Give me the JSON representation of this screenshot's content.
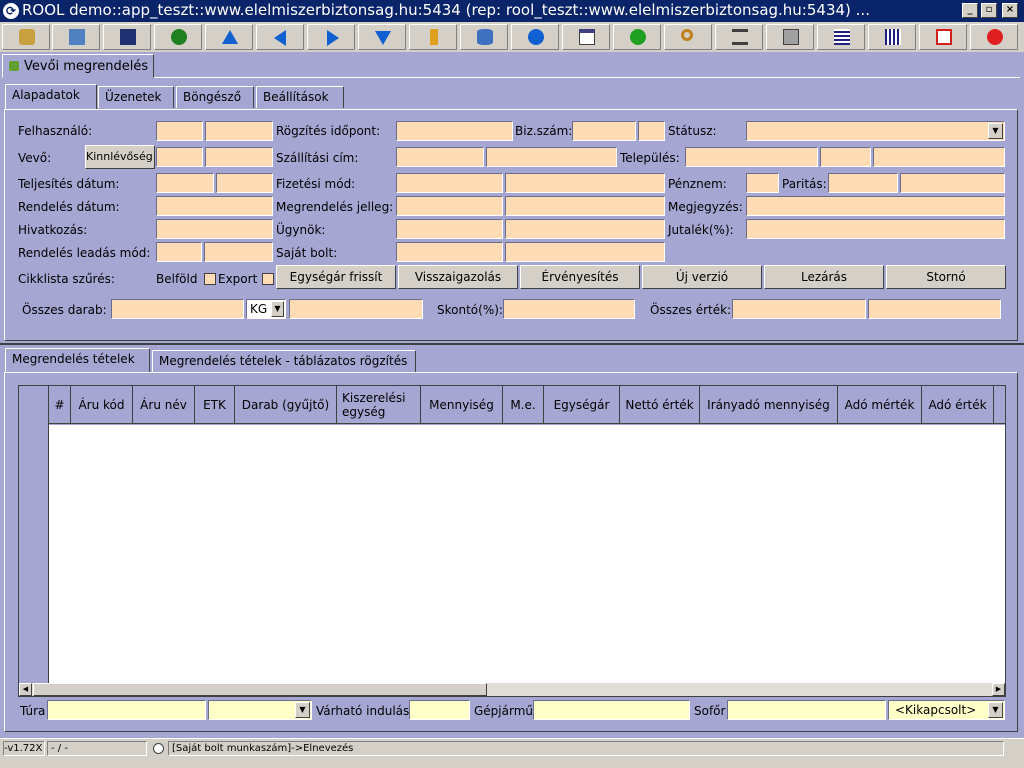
{
  "window": {
    "title": "ROOL demo::app_teszt::www.elelmiszerbiztonsag.hu:5434 (rep: rool_teszt::www.elelmiszerbiztonsag.hu:5434) ...",
    "app_icon": "refresh-circle-icon",
    "min": "_",
    "max": "▫",
    "close": "×"
  },
  "toolbar": {
    "icons": [
      "tools-icon",
      "open-folder-icon",
      "save-icon",
      "undo-arrow-icon",
      "first-record-icon",
      "prev-arrow-icon",
      "next-arrow-icon",
      "last-record-icon",
      "edit-pencil-icon",
      "database-icon",
      "info-icon",
      "window-icon",
      "refresh-icon",
      "search-magnifier-icon",
      "filter-icon",
      "print-icon",
      "grid-export-icon",
      "grid-icon",
      "fit-window-icon",
      "exit-icon"
    ]
  },
  "doc_tab": {
    "label": "Vevői megrendelés",
    "icon": "order-icon"
  },
  "top_tabs": [
    "Alapadatok",
    "Üzenetek",
    "Böngésző",
    "Beállítások"
  ],
  "form": {
    "felhasznalo": "Felhasználó:",
    "rogzites_idopont": "Rögzítés időpont:",
    "biz_szam": "Biz.szám:",
    "statusz": "Státusz:",
    "vevo": "Vevő:",
    "kinnlevoseg_button": "Kinnlévőség",
    "szallitasi_cim": "Szállítási cím:",
    "telepules": "Település:",
    "teljesites_datum": "Teljesítés dátum:",
    "fizetesi_mod": "Fizetési mód:",
    "penznem": "Pénznem:",
    "paritas": "Paritás:",
    "rendeles_datum": "Rendelés dátum:",
    "megrendeles_jelleg": "Megrendelés jelleg:",
    "megjegyzes": "Megjegyzés:",
    "hivatkozas": "Hivatkozás:",
    "ugynok": "Ügynök:",
    "jutalek": "Jutalék(%):",
    "rendeles_leadas_mod": "Rendelés leadás mód:",
    "sajat_bolt": "Saját bolt:",
    "cikklista_szures": "Cikklista szűrés:",
    "belfold": "Belföld",
    "export": "Export",
    "osszes_darab": "Összes darab:",
    "unit_value": "KG",
    "skonto": "Skontó(%):",
    "osszes_ertek": "Összes érték:"
  },
  "action_buttons": [
    "Egységár frissít",
    "Visszaigazolás",
    "Érvényesítés",
    "Új verzió",
    "Lezárás",
    "Stornó"
  ],
  "bottom_tabs": [
    "Megrendelés tételek",
    "Megrendelés tételek - táblázatos rögzítés"
  ],
  "table": {
    "columns": [
      "#",
      "Áru kód",
      "Áru név",
      "ETK",
      "Darab (gyűjtő)",
      "Kiszerelési egység",
      "Mennyiség",
      "M.e.",
      "Egységár",
      "Nettó érték",
      "Irányadó mennyiség",
      "Adó mérték",
      "Adó érték"
    ]
  },
  "footer": {
    "tura": "Túra",
    "varhato_indulas": "Várható indulás",
    "gepjarmu": "Gépjármű",
    "sofor": "Sofőr",
    "kikapcsolt": "<Kikapcsolt>"
  },
  "status": {
    "version": "-v1.72X",
    "separator": "- / -",
    "message": "[Saját bolt munkaszám]->Elnevezés"
  },
  "colors": {
    "background": "#a6a6d3",
    "field": "#ffdcb4",
    "field_yellow": "#ffffc8",
    "titlebar": "#0a246a"
  }
}
